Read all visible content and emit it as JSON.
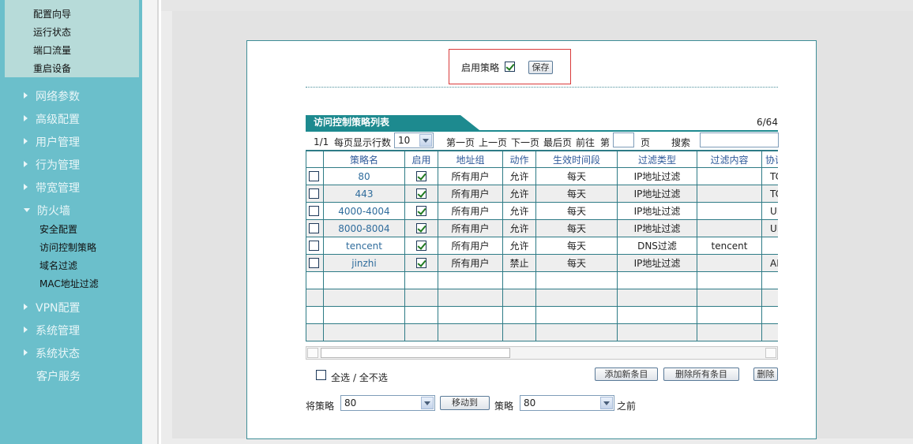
{
  "sidebar": {
    "top_items": [
      "配置向导",
      "运行状态",
      "端口流量",
      "重启设备"
    ],
    "nav_items": [
      "网络参数",
      "高级配置",
      "用户管理",
      "行为管理",
      "带宽管理",
      "防火墙"
    ],
    "firewall_items": [
      "安全配置",
      "访问控制策略",
      "域名过滤",
      "MAC地址过滤"
    ],
    "bottom_items": [
      "VPN配置",
      "系统管理",
      "系统状态"
    ],
    "customer_service": "客户服务"
  },
  "enable_policy": {
    "label": "启用策略",
    "checked": true,
    "save_label": "保存"
  },
  "table": {
    "title": "访问控制策略列表",
    "count": "6/64",
    "page_info": "1/1",
    "per_page_label": "每页显示行数",
    "per_page_value": "10",
    "first_page": "第一页",
    "prev_page": "上一页",
    "next_page": "下一页",
    "last_page": "最后页",
    "goto": "前往",
    "page_prefix": "第",
    "page_suffix": "页",
    "search_label": "搜索",
    "headers": [
      "策略名",
      "启用",
      "地址组",
      "动作",
      "生效时间段",
      "过滤类型",
      "过滤内容",
      "协议"
    ],
    "rows": [
      {
        "name": "80",
        "enabled": true,
        "group": "所有用户",
        "action": "允许",
        "time": "每天",
        "type": "IP地址过滤",
        "content": "",
        "proto": "TCP"
      },
      {
        "name": "443",
        "enabled": true,
        "group": "所有用户",
        "action": "允许",
        "time": "每天",
        "type": "IP地址过滤",
        "content": "",
        "proto": "TCP"
      },
      {
        "name": "4000-4004",
        "enabled": true,
        "group": "所有用户",
        "action": "允许",
        "time": "每天",
        "type": "IP地址过滤",
        "content": "",
        "proto": "UDP"
      },
      {
        "name": "8000-8004",
        "enabled": true,
        "group": "所有用户",
        "action": "允许",
        "time": "每天",
        "type": "IP地址过滤",
        "content": "",
        "proto": "UDP"
      },
      {
        "name": "tencent",
        "enabled": true,
        "group": "所有用户",
        "action": "允许",
        "time": "每天",
        "type": "DNS过滤",
        "content": "tencent",
        "proto": ""
      },
      {
        "name": "jinzhi",
        "enabled": true,
        "group": "所有用户",
        "action": "禁止",
        "time": "每天",
        "type": "IP地址过滤",
        "content": "",
        "proto": "ALL"
      }
    ]
  },
  "actions": {
    "select_all": "全选",
    "deselect_all": "/ 全不选",
    "add_label": "添加新条目",
    "delete_all_label": "删除所有条目",
    "delete_label": "删除"
  },
  "move": {
    "prefix": "将策略",
    "from_value": "80",
    "button_label": "移动到",
    "mid": "策略",
    "to_value": "80",
    "suffix": "之前"
  }
}
